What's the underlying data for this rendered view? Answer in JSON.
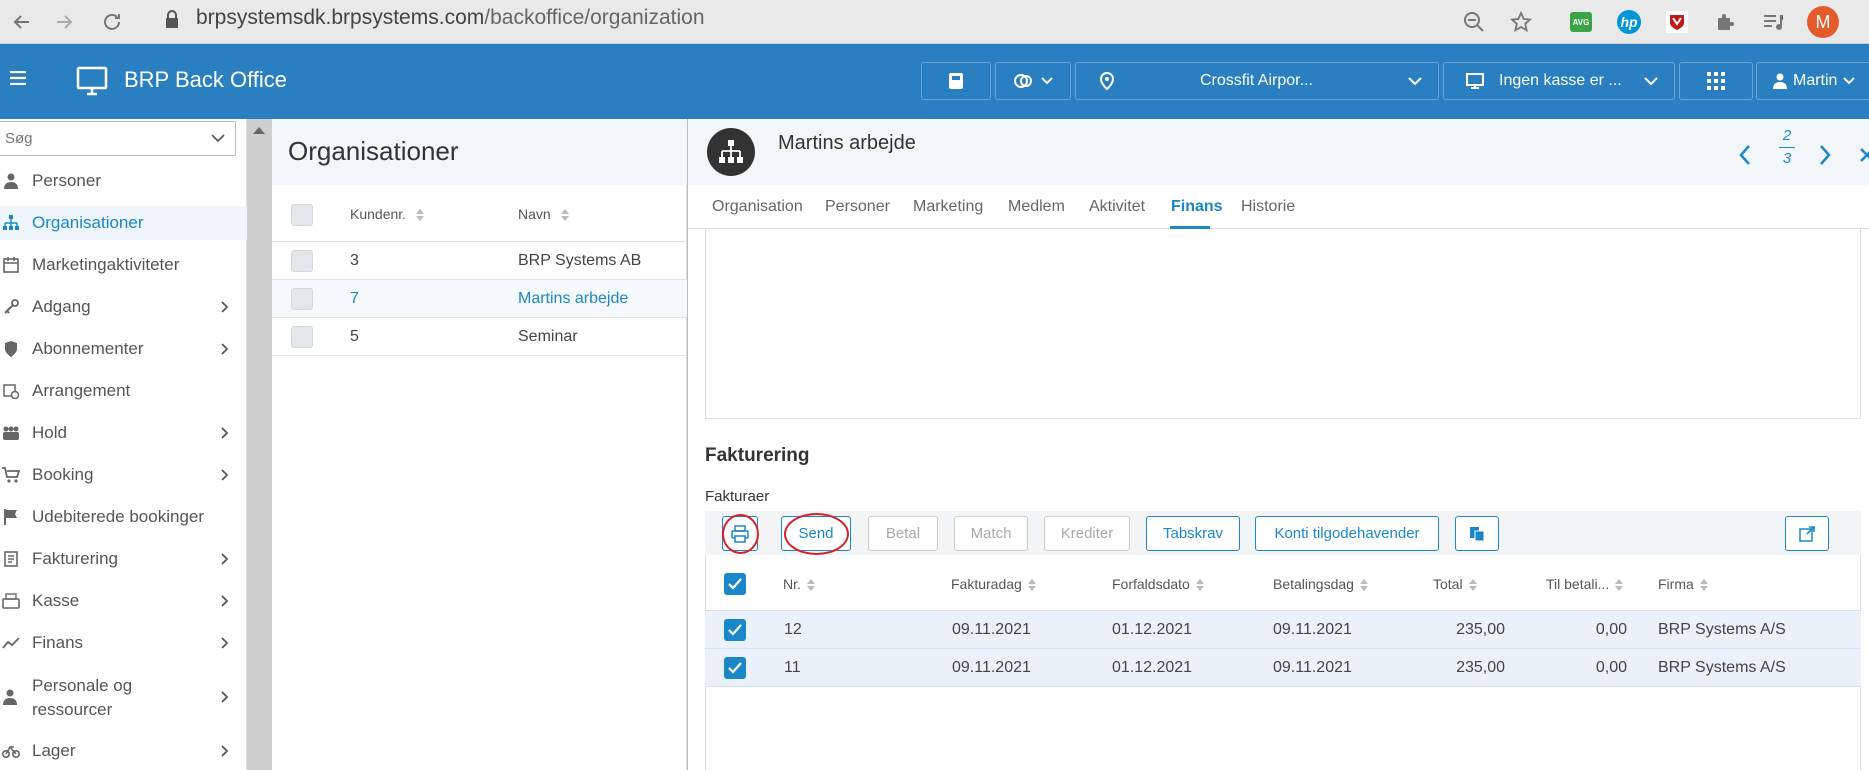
{
  "browser": {
    "url_prefix": "brpsystemsdk.brpsystems.com",
    "url_path": "/backoffice/organization",
    "profile_initial": "M",
    "ext_avg_label": "AVG",
    "ext_hp_label": "hp"
  },
  "app": {
    "title": "BRP Back Office",
    "location": "Crossfit Airpor...",
    "register": "Ingen kasse er ...",
    "user": "Martin"
  },
  "sidebar": {
    "search_placeholder": "Søg",
    "items": [
      {
        "label": "Personer",
        "icon": "person-icon",
        "arrow": false
      },
      {
        "label": "Organisationer",
        "icon": "org-chart-icon",
        "arrow": false
      },
      {
        "label": "Marketingaktiviteter",
        "icon": "calendar-icon",
        "arrow": false
      },
      {
        "label": "Adgang",
        "icon": "key-icon",
        "arrow": true
      },
      {
        "label": "Abonnementer",
        "icon": "shield-icon",
        "arrow": true
      },
      {
        "label": "Arrangement",
        "icon": "calendar-clock-icon",
        "arrow": false
      },
      {
        "label": "Hold",
        "icon": "group-icon",
        "arrow": true
      },
      {
        "label": "Booking",
        "icon": "cart-icon",
        "arrow": true
      },
      {
        "label": "Udebiterede bookinger",
        "icon": "flag-icon",
        "arrow": false
      },
      {
        "label": "Fakturering",
        "icon": "invoice-icon",
        "arrow": true
      },
      {
        "label": "Kasse",
        "icon": "cash-register-icon",
        "arrow": true
      },
      {
        "label": "Finans",
        "icon": "trend-icon",
        "arrow": true
      },
      {
        "label": "Personale og",
        "label2": "ressourcer",
        "icon": "staff-icon",
        "arrow": true
      },
      {
        "label": "Lager",
        "icon": "bicycle-icon",
        "arrow": true
      }
    ]
  },
  "list": {
    "title": "Organisationer",
    "col_kundenr": "Kundenr.",
    "col_navn": "Navn",
    "rows": [
      {
        "nr": "3",
        "name": "BRP Systems AB"
      },
      {
        "nr": "7",
        "name": "Martins arbejde"
      },
      {
        "nr": "5",
        "name": "Seminar"
      }
    ]
  },
  "detail": {
    "title": "Martins arbejde",
    "pager_current": "2",
    "pager_total": "3",
    "tabs": [
      "Organisation",
      "Personer",
      "Marketing",
      "Medlem",
      "Aktivitet",
      "Finans",
      "Historie"
    ],
    "section": "Fakturering",
    "subsection": "Fakturaer",
    "buttons": {
      "send": "Send",
      "betal": "Betal",
      "match": "Match",
      "krediter": "Krediter",
      "tabskrav": "Tabskrav",
      "konti": "Konti tilgodehavender"
    },
    "columns": {
      "nr": "Nr.",
      "fakturadag": "Fakturadag",
      "forfaldsdato": "Forfaldsdato",
      "betalingsdag": "Betalingsdag",
      "total": "Total",
      "til_betaling": "Til betali...",
      "firma": "Firma"
    },
    "invoices": [
      {
        "nr": "12",
        "fakturadag": "09.11.2021",
        "forfaldsdato": "01.12.2021",
        "betalingsdag": "09.11.2021",
        "total": "235,00",
        "til_betaling": "0,00",
        "firma": "BRP Systems A/S"
      },
      {
        "nr": "11",
        "fakturadag": "09.11.2021",
        "forfaldsdato": "01.12.2021",
        "betalingsdag": "09.11.2021",
        "total": "235,00",
        "til_betaling": "0,00",
        "firma": "BRP Systems A/S"
      }
    ]
  },
  "colors": {
    "brand": "#2a7fc1",
    "accent": "#1a87c8",
    "annotation": "#d8222a"
  }
}
